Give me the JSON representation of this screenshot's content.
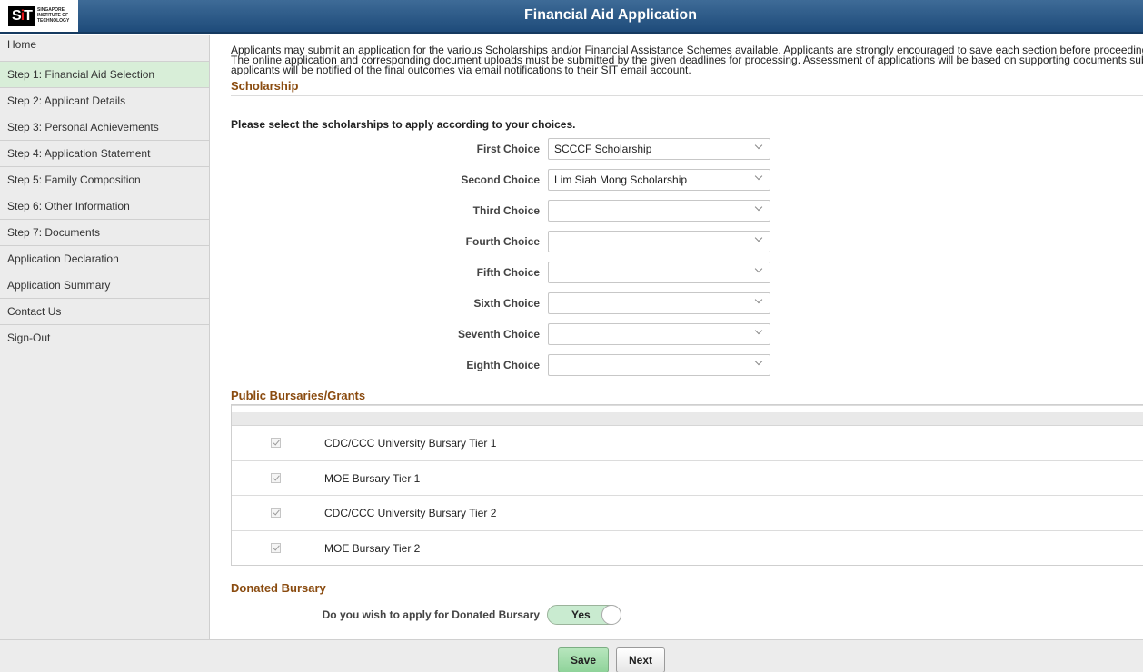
{
  "header": {
    "title": "Financial Aid Application",
    "logo_text": "SIT",
    "logo_subtext": "SINGAPORE INSTITUTE OF TECHNOLOGY"
  },
  "sidebar": {
    "items": [
      {
        "label": "Home"
      },
      {
        "label": "Step 1: Financial Aid Selection",
        "active": true
      },
      {
        "label": "Step 2: Applicant Details"
      },
      {
        "label": "Step 3: Personal Achievements"
      },
      {
        "label": "Step 4: Application Statement"
      },
      {
        "label": "Step 5: Family Composition"
      },
      {
        "label": "Step 6: Other Information"
      },
      {
        "label": "Step 7: Documents"
      },
      {
        "label": "Application Declaration"
      },
      {
        "label": "Application Summary"
      },
      {
        "label": "Contact Us"
      },
      {
        "label": "Sign-Out"
      }
    ]
  },
  "intro": {
    "line1": "Applicants may submit an application for the various Scholarships and/or Financial Assistance Schemes available. Applicants are strongly encouraged to save each section before proceeding to",
    "line2": "The online application and corresponding document uploads must be submitted by the given deadlines for processing. Assessment of applications will be based on supporting documents submit",
    "line3": "applicants will be notified of the final outcomes via email notifications to their SIT email account."
  },
  "scholarship": {
    "title": "Scholarship",
    "prompt": "Please select the scholarships to apply according to your choices.",
    "choices": [
      {
        "label": "First Choice",
        "value": "SCCCF Scholarship"
      },
      {
        "label": "Second Choice",
        "value": "Lim Siah Mong Scholarship"
      },
      {
        "label": "Third Choice",
        "value": ""
      },
      {
        "label": "Fourth Choice",
        "value": ""
      },
      {
        "label": "Fifth Choice",
        "value": ""
      },
      {
        "label": "Sixth Choice",
        "value": ""
      },
      {
        "label": "Seventh Choice",
        "value": ""
      },
      {
        "label": "Eighth Choice",
        "value": ""
      }
    ]
  },
  "bursaries": {
    "title": "Public Bursaries/Grants",
    "items": [
      {
        "label": "CDC/CCC University Bursary Tier 1",
        "checked": true
      },
      {
        "label": "MOE Bursary Tier 1",
        "checked": true
      },
      {
        "label": "CDC/CCC University Bursary Tier 2",
        "checked": true
      },
      {
        "label": "MOE Bursary Tier 2",
        "checked": true
      }
    ]
  },
  "donated": {
    "title": "Donated Bursary",
    "question": "Do you wish to apply for Donated Bursary",
    "toggle_value": "Yes"
  },
  "footer": {
    "save_label": "Save",
    "next_label": "Next"
  }
}
